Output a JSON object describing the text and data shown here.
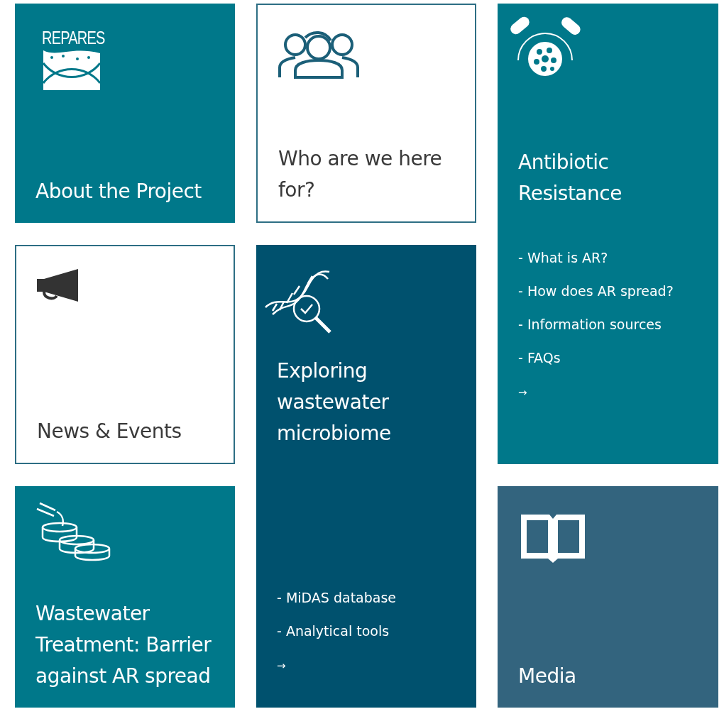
{
  "tiles": [
    {
      "kind": "logo",
      "color": "#00788a",
      "logo_text": "REPARES",
      "title": "About the Project"
    },
    {
      "kind": "people",
      "color": "#ffffff",
      "title": "Who are we here for?"
    },
    {
      "kind": "pills",
      "color": "#00788a",
      "title": "Antibiotic Resistance",
      "links": [
        "- What is AR?",
        "- How does AR spread?",
        "- Information sources",
        "- FAQs"
      ],
      "arrow": "→"
    },
    {
      "kind": "megaphone",
      "color": "#ffffff",
      "title": "News & Events"
    },
    {
      "kind": "dna",
      "color": "#00516e",
      "title": "Exploring wastewater microbiome",
      "links": [
        "- MiDAS database",
        "- Analytical tools"
      ],
      "arrow": "→"
    },
    {
      "kind": "tanks",
      "color": "#00788a",
      "title": "Wastewater Treatment: Barrier against AR spread"
    },
    {
      "kind": "book",
      "color": "#33647e",
      "title": "Media"
    }
  ]
}
